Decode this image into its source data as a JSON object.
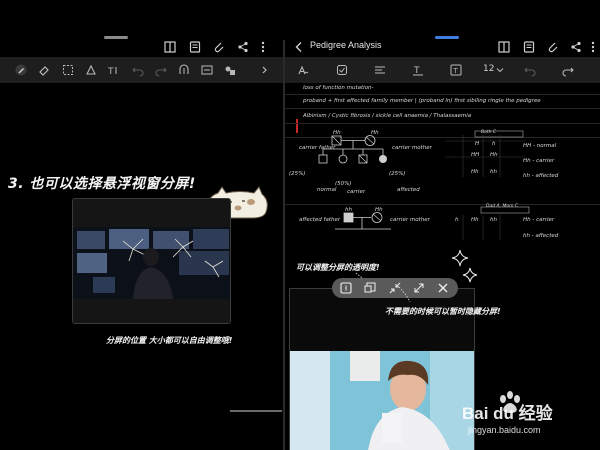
{
  "left_pane": {
    "heading": "3. 也可以选择悬浮视窗分屏!",
    "caption": "分屏的位置 大小都可以自由调整哦!"
  },
  "right_pane": {
    "title": "Pedigree Analysis",
    "font_size_value": "12",
    "notes": {
      "line1": "loss of function mutation-",
      "line2": "proband + first affected family member | (proband ln) first sibiling ringle the pedigree",
      "line3": "Albinism / Cystic fibrosis / sickle cell anaemia / Thalassaemia",
      "box1_label": "Both C",
      "carrier_father": "carrier father",
      "carrier_mother": "carrier mother",
      "normal": "normal",
      "carrier": "carrier",
      "affected": "affected",
      "ratio1": "(25%)",
      "ratio2": "(50%)",
      "ratio3": "(25%)",
      "affected_father": "affected father",
      "box2_label": "Dad A, Mom C",
      "hh": "hh",
      "Hh": "Hh",
      "HH": "HH",
      "H": "H",
      "h": "h",
      "HH_normal": "HH - normal",
      "Hh_carrier": "Hh - carrier",
      "hh_affected": "hh - affected",
      "Hh_carrier2": "Hh - carrier",
      "hh_affected2": "hh - affected"
    },
    "annotation_transparency": "可以调整分屏的透明度!",
    "annotation_hide": "不需要的时候可以暂时隐藏分屏!"
  },
  "colors": {
    "left_handle": "#8a8a8a",
    "right_handle": "#3f7fe0",
    "background": "#000000",
    "toolbar": "#1e1e1e",
    "control_pill": "#5a5a5a"
  },
  "icons": [
    "book-icon",
    "note-icon",
    "attach-icon",
    "share-icon",
    "more-icon",
    "back-chevron-icon",
    "pen-icon",
    "eraser-icon",
    "lasso-icon",
    "text-icon",
    "undo-icon",
    "redo-icon",
    "grip-icon",
    "opacity-icon",
    "minimize-icon",
    "hide-icon",
    "fullscreen-icon",
    "close-icon"
  ],
  "watermark": {
    "brand": "Bai du 经验",
    "url": "jingyan.baidu.com"
  }
}
